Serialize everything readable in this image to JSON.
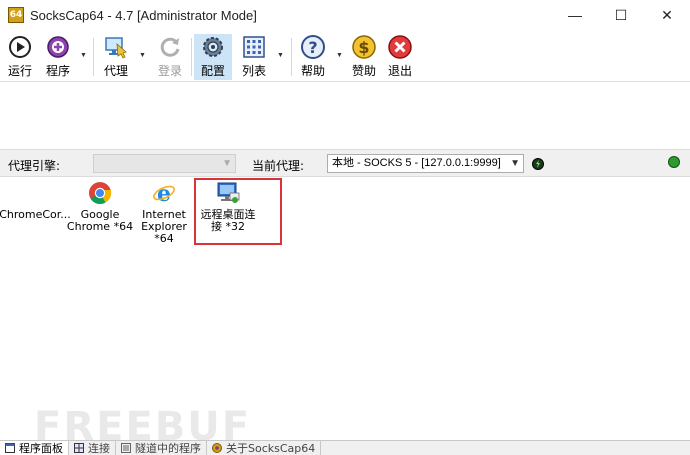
{
  "window": {
    "title": "SocksCap64 - 4.7 [Administrator Mode]",
    "app_icon_text": "64",
    "minimize": "—",
    "maximize": "☐",
    "close": "✕"
  },
  "toolbar": {
    "run": "运行",
    "programs": "程序",
    "proxy": "代理",
    "login": "登录",
    "config": "配置",
    "list": "列表",
    "help": "帮助",
    "donate": "赞助",
    "exit": "退出"
  },
  "proxy_bar": {
    "engine_label": "代理引擎:",
    "engine_value": "",
    "current_label": "当前代理:",
    "current_value": "本地 - SOCKS 5 - [127.0.0.1:9999]",
    "colors": {
      "status_green": "#2f9a2f",
      "status_dark": "#1a3a1a"
    }
  },
  "programs": [
    {
      "label": "ChromeCor..."
    },
    {
      "label": "Google Chrome *64"
    },
    {
      "label": "Internet Explorer *64"
    },
    {
      "label": "远程桌面连接 *32"
    }
  ],
  "watermark": "FREEBUF",
  "tabs": [
    {
      "label": "程序面板"
    },
    {
      "label": "连接"
    },
    {
      "label": "隧道中的程序"
    },
    {
      "label": "关于SocksCap64"
    }
  ],
  "colors": {
    "highlight": "#d9343a",
    "selected": "#cde4f7"
  }
}
